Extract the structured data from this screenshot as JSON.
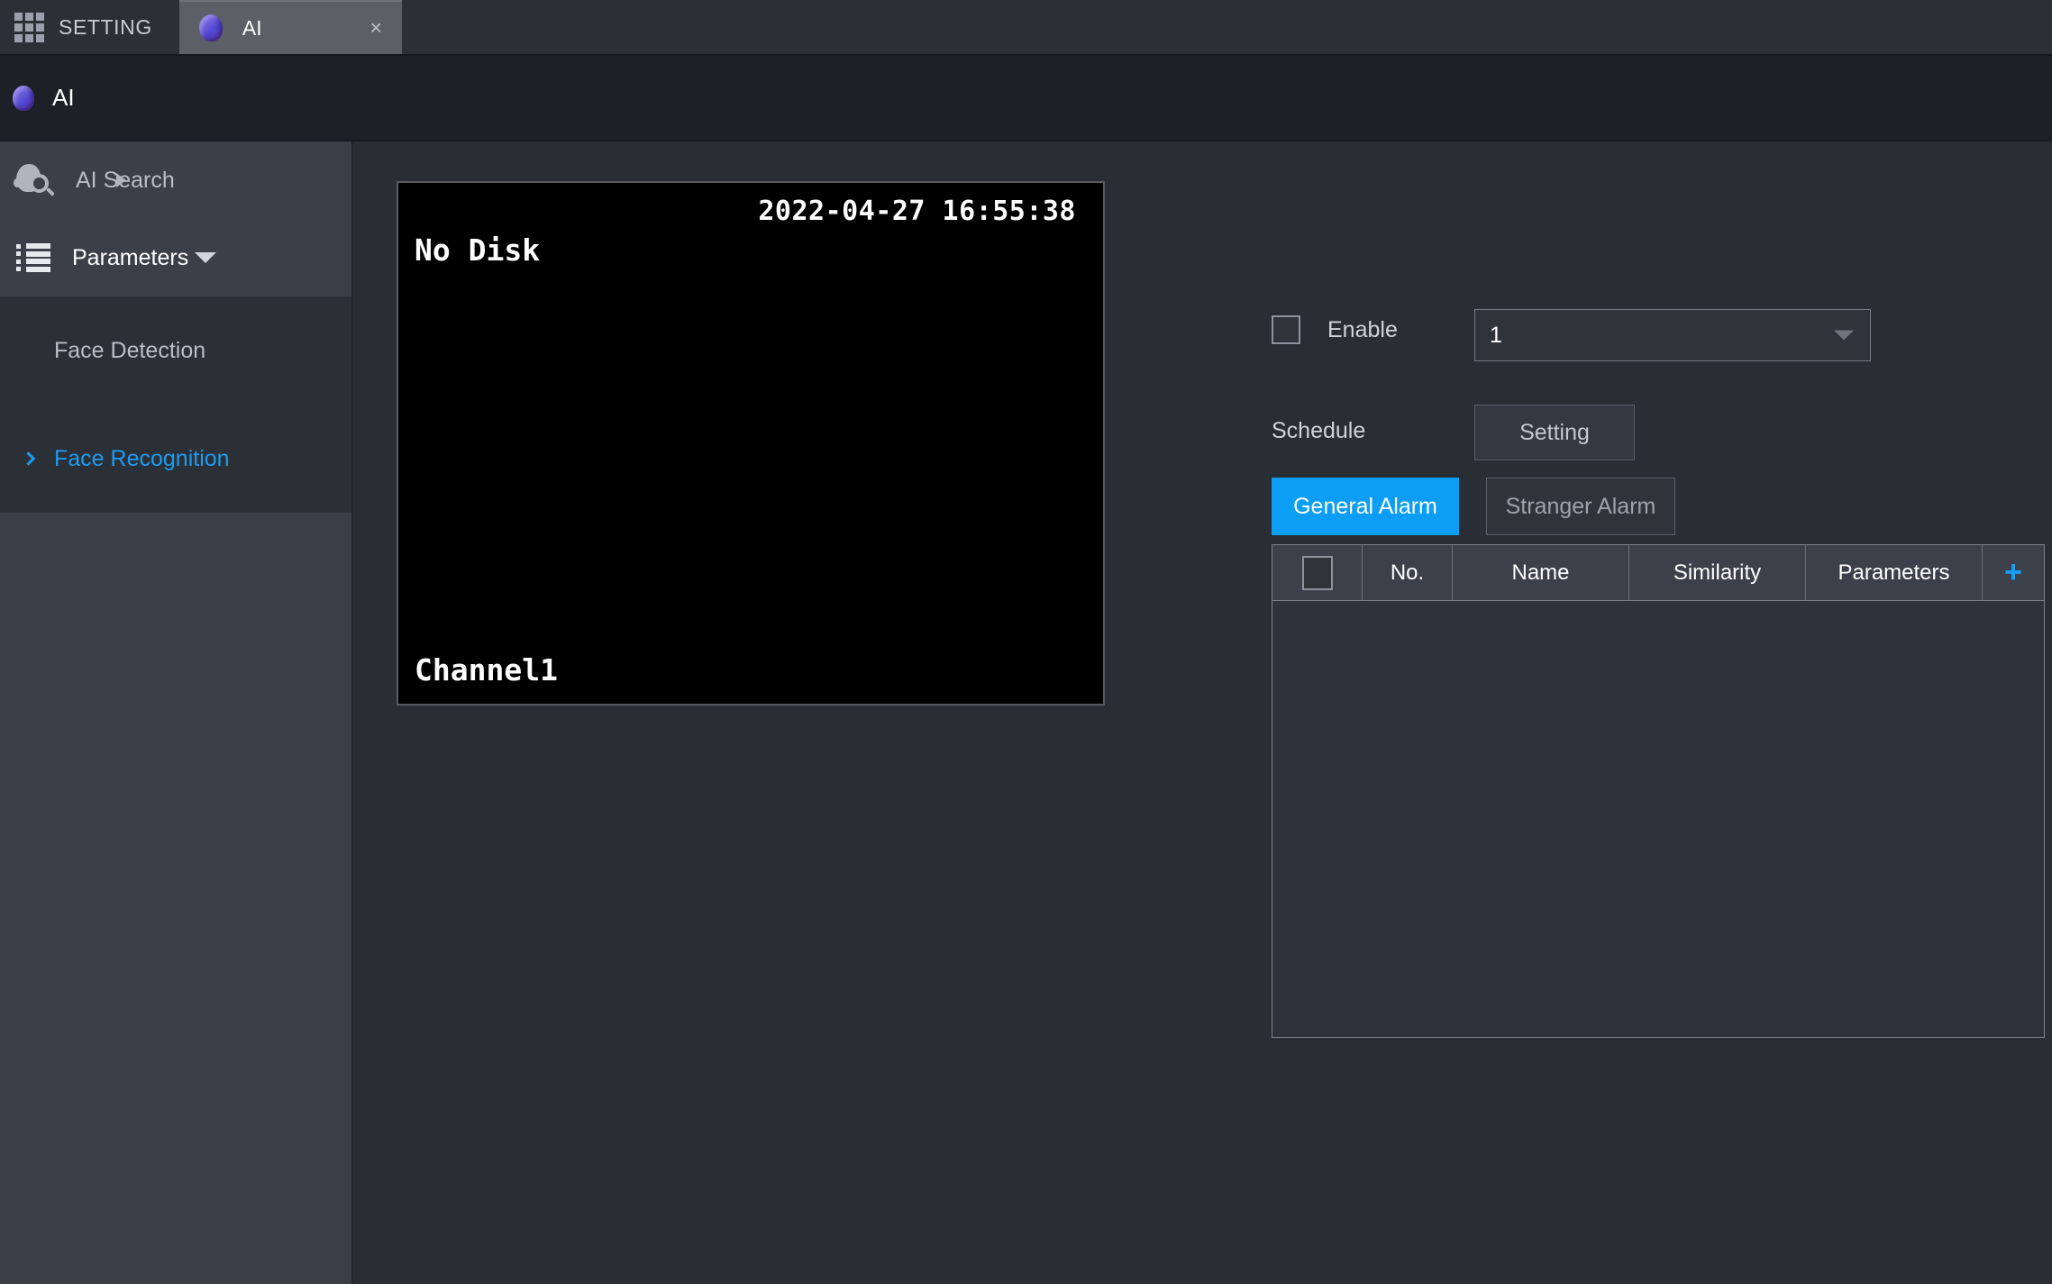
{
  "titlebar": {
    "app_menu_icon": "grid-icon",
    "setting_label": "SETTING",
    "tab": {
      "icon": "ai-brain-icon",
      "label": "AI",
      "close": "×"
    }
  },
  "breadcrumb": {
    "icon": "ai-brain-icon",
    "label": "AI"
  },
  "sidebar": {
    "items": [
      {
        "label": "AI Search",
        "icon": "face-search-icon",
        "expand_icon": "arrow-right-icon",
        "active": false
      },
      {
        "label": "Parameters",
        "icon": "list-icon",
        "expand_icon": "arrow-down-icon",
        "active": false
      }
    ],
    "submenu": [
      {
        "label": "Face Detection",
        "active": false
      },
      {
        "label": "Face Recognition",
        "active": true,
        "icon": "chevron-right-icon"
      }
    ]
  },
  "preview": {
    "timestamp": "2022-04-27 16:55:38",
    "status": "No Disk",
    "channel": "Channel1"
  },
  "settings": {
    "enable_label": "Enable",
    "enable_checked": false,
    "channel_value": "1",
    "channel_options": [
      "1"
    ],
    "schedule_label": "Schedule",
    "schedule_button": "Setting"
  },
  "alarm_tabs": [
    {
      "label": "General Alarm",
      "active": true
    },
    {
      "label": "Stranger Alarm",
      "active": false
    }
  ],
  "table": {
    "columns": [
      "No.",
      "Name",
      "Similarity",
      "Parameters"
    ],
    "add_icon": "plus-icon",
    "add_label": "+",
    "rows": []
  },
  "colors": {
    "accent": "#0b9ef4",
    "link": "#1e9bf0",
    "sidebar_bg": "#3a3f48",
    "main_bg": "#292d34",
    "table_header_bg": "#3b404a"
  }
}
